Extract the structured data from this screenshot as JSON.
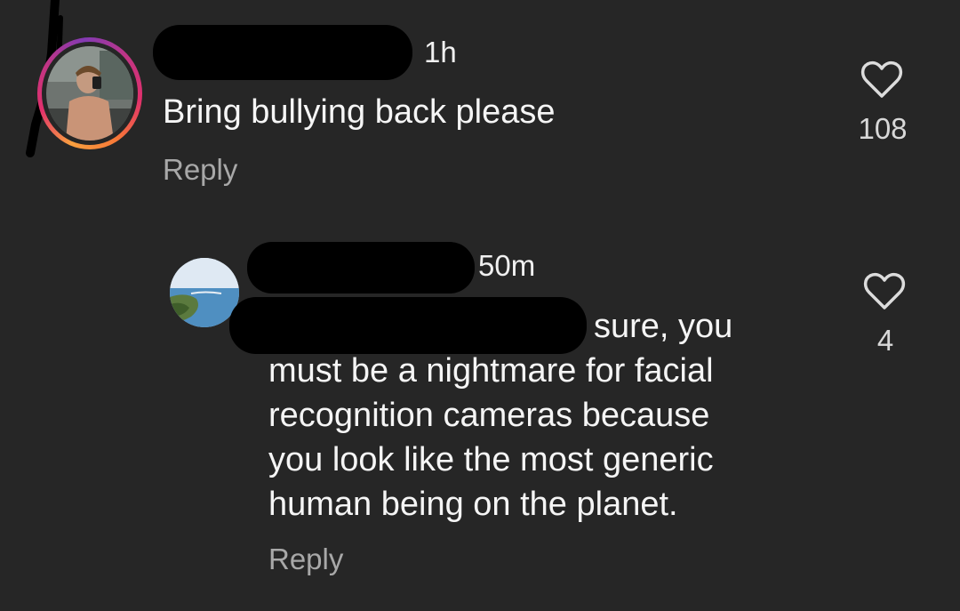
{
  "comments": [
    {
      "time": "1h",
      "text": "Bring bullying back please",
      "reply_label": "Reply",
      "like_icon": "heart-outline",
      "likes": "108",
      "avatar_ring": true
    },
    {
      "time": "50m",
      "text_line1": "sure, you",
      "text_rest": [
        "must be a nightmare for facial",
        "recognition cameras because",
        "you look like the most generic",
        "human being on the planet."
      ],
      "reply_label": "Reply",
      "like_icon": "heart-outline",
      "likes": "4"
    }
  ],
  "colors": {
    "background": "#262626",
    "text": "#f5f5f5",
    "secondary": "#a8a8a8",
    "story_ring": "#e1306c"
  }
}
